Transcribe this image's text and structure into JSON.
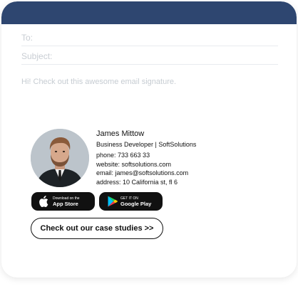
{
  "email": {
    "to_placeholder": "To:",
    "subject_placeholder": "Subject:",
    "body_text": "Hi! Check out this awesome email signature."
  },
  "signature": {
    "name": "James Mittow",
    "title": "Business Developer | SoftSolutions",
    "phone": "phone:  733 663 33",
    "website": "website:  softsolutions.com",
    "email": "email:  james@softsolutions.com",
    "address": "address:  10 California st, fl 6"
  },
  "buttons": {
    "app_store_small": "Download on the",
    "app_store_big": "App Store",
    "google_play_small": "GET IT ON",
    "google_play_big": "Google Play",
    "cta": "Check out our case studies >>"
  },
  "colors": {
    "header": "#2e4670",
    "placeholder": "#c8cdd3",
    "text": "#111111"
  }
}
